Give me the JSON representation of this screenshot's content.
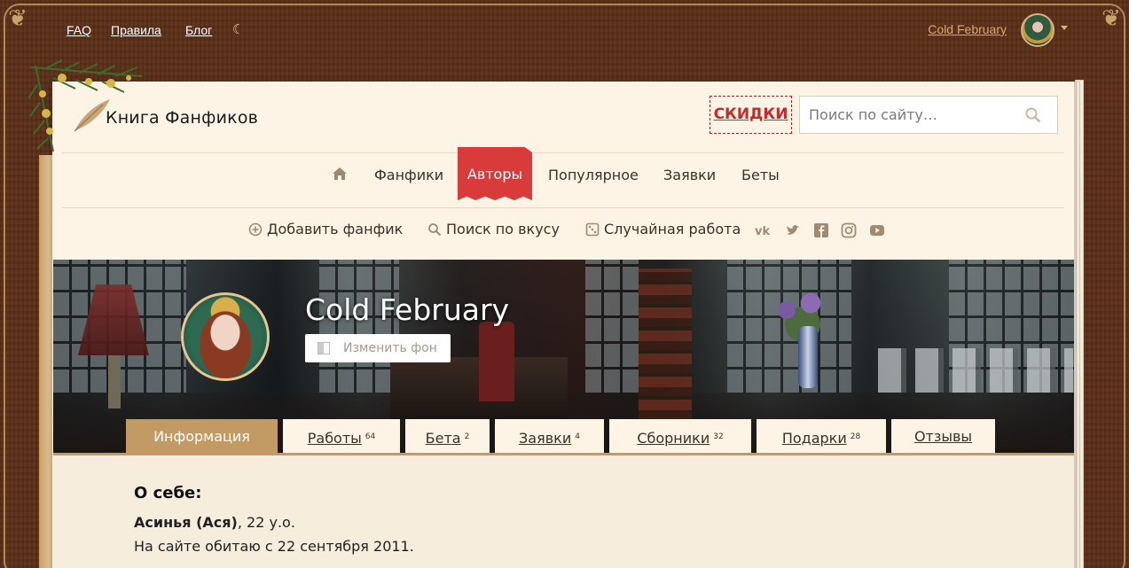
{
  "topbar": {
    "links": [
      "FAQ",
      "Правила",
      "Блог"
    ],
    "username": "Cold February"
  },
  "header": {
    "logo_text": "Книга Фанфиков",
    "sale_label": "СКИДКИ",
    "search_placeholder": "Поиск по сайту…"
  },
  "main_nav": {
    "items": [
      "Фанфики",
      "Авторы",
      "Популярное",
      "Заявки",
      "Беты"
    ],
    "active": "Авторы"
  },
  "sub_nav": {
    "add": "Добавить фанфик",
    "taste": "Поиск по вкусу",
    "random": "Случайная работа"
  },
  "profile": {
    "name": "Cold February",
    "change_bg": "Изменить фон"
  },
  "tabs": [
    {
      "label": "Информация",
      "count": ""
    },
    {
      "label": "Работы",
      "count": "64"
    },
    {
      "label": "Бета",
      "count": "2"
    },
    {
      "label": "Заявки",
      "count": "4"
    },
    {
      "label": "Сборники",
      "count": "32"
    },
    {
      "label": "Подарки",
      "count": "28"
    },
    {
      "label": "Отзывы",
      "count": ""
    }
  ],
  "about": {
    "title": "О себе:",
    "name": "Асинья (Ася)",
    "age": ", 22 у.о.",
    "since": "На сайте обитаю с 22 сентября 2011."
  },
  "colors": {
    "accent_red": "#d93b3b",
    "tab_active": "#c29a63",
    "background_wood": "#5a2f17"
  }
}
